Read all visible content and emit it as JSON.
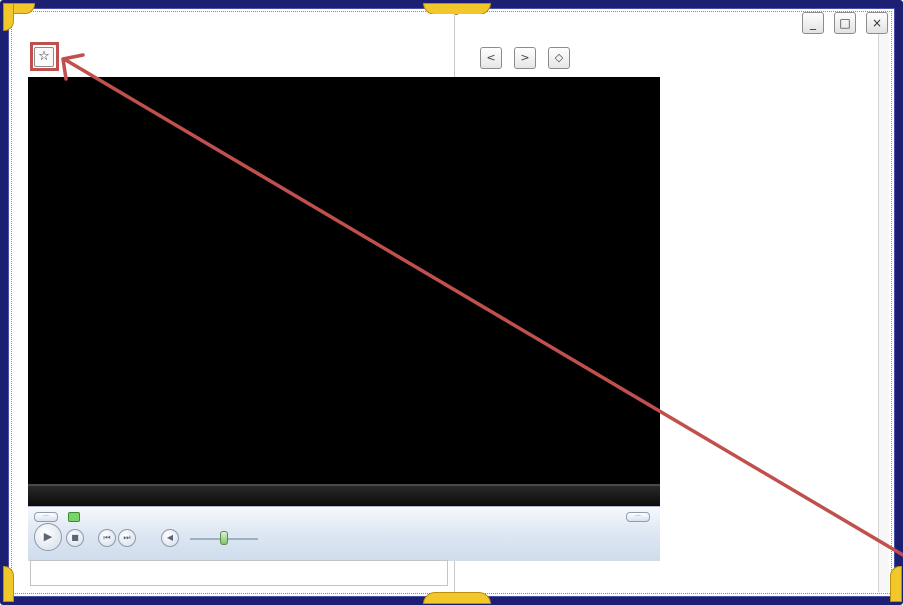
{
  "window_controls": {
    "minimize_icon": "minimize-icon",
    "maximize_icon": "maximize-icon",
    "close_icon": "close-icon",
    "minimize_glyph": "_",
    "maximize_glyph": "□",
    "close_glyph": "×"
  },
  "toolbar": {
    "star_icon": "star-icon",
    "star_glyph": "☆"
  },
  "navigation": {
    "back_icon": "chevron-left-icon",
    "forward_icon": "chevron-right-icon",
    "home_icon": "diamond-icon",
    "back_glyph": "<",
    "forward_glyph": ">",
    "home_glyph": "◇"
  },
  "transport": {
    "play_glyph": "▶",
    "stop_glyph": "■",
    "prev_glyph": "⏮",
    "next_glyph": "⏭",
    "mute_glyph": "◀",
    "pill_glyph": "···"
  },
  "colors": {
    "frame": "#1d1f73",
    "accent_yellow": "#f1c72a",
    "annotation": "#c0504d",
    "video_bg": "#000000"
  }
}
